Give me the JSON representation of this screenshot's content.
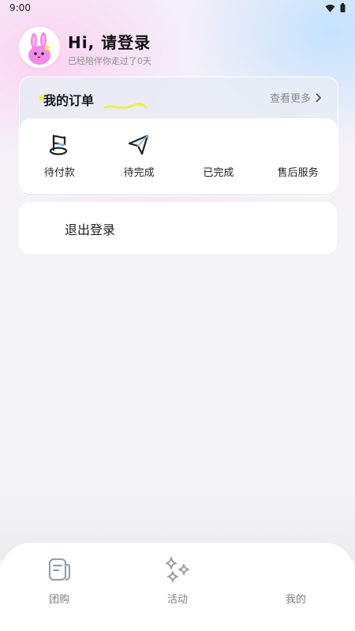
{
  "status_bar": {
    "time": "9:00",
    "icons": [
      "wifi-icon",
      "battery-icon"
    ]
  },
  "profile": {
    "avatar_icon": "bunny-avatar-icon",
    "greeting": "Hi, 请登录",
    "subtitle": "已经陪伴你走过了0天"
  },
  "orders": {
    "title": "我的订单",
    "view_more": "查看更多",
    "items": [
      {
        "label": "待付款",
        "icon": "flag-icon"
      },
      {
        "label": "待完成",
        "icon": "paper-plane-icon"
      },
      {
        "label": "已完成",
        "icon": ""
      },
      {
        "label": "售后服务",
        "icon": ""
      }
    ]
  },
  "logout": {
    "label": "退出登录"
  },
  "tabbar": {
    "tabs": [
      {
        "label": "团购",
        "icon": "notes-icon"
      },
      {
        "label": "活动",
        "icon": "sparkles-icon"
      },
      {
        "label": "我的",
        "icon": ""
      }
    ]
  },
  "colors": {
    "accent_yellow": "#f3ea4a",
    "icon_blue": "#7fc2e8",
    "text_primary": "#111111",
    "text_secondary": "#8d8d8d"
  }
}
